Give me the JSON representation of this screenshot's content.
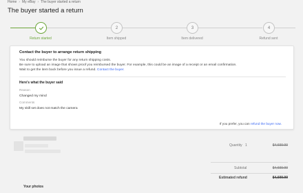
{
  "breadcrumb": {
    "items": [
      "Home",
      "My eBay",
      "The buyer started a return"
    ]
  },
  "page_title": "The buyer started a return",
  "colors": {
    "success_green": "#6ba539",
    "link_blue": "#3665f3"
  },
  "progress": {
    "current_step": 1,
    "steps": [
      {
        "number": "✓",
        "label": "Return started",
        "state": "done"
      },
      {
        "number": "2",
        "label": "Item shipped",
        "state": "pending"
      },
      {
        "number": "3",
        "label": "Item delivered",
        "state": "pending"
      },
      {
        "number": "4",
        "label": "Refund sent",
        "state": "pending"
      }
    ]
  },
  "card": {
    "heading": "Contact the buyer to arrange return shipping",
    "line1": "You should reimburse the buyer for any return shipping costs.",
    "line2": "Be sure to upload an image that shows proof you reimbursed the buyer. For example, this could be an image of a receipt or an email confirmation.",
    "line3_text": "Wait to get the item back before you issue a refund.",
    "line3_link": "Contact the buyer.",
    "buyer_said_heading": "Here's what the buyer said",
    "reason_label": "Reason",
    "reason_value": "Changed my mind",
    "comments_label": "Comments",
    "comments_value": "My skill set does not match the camera",
    "footer_text": "If you prefer, you can",
    "footer_link": "refund the buyer now."
  },
  "order": {
    "quantity_label": "Quantity",
    "quantity_value": "1",
    "item_price": "$4,699.99",
    "subtotal_label": "Subtotal",
    "subtotal_value": "$4,699.99",
    "estimated_refund_label": "Estimated refund",
    "estimated_refund_value": "$4,699.99",
    "photos_heading": "Your photos"
  }
}
